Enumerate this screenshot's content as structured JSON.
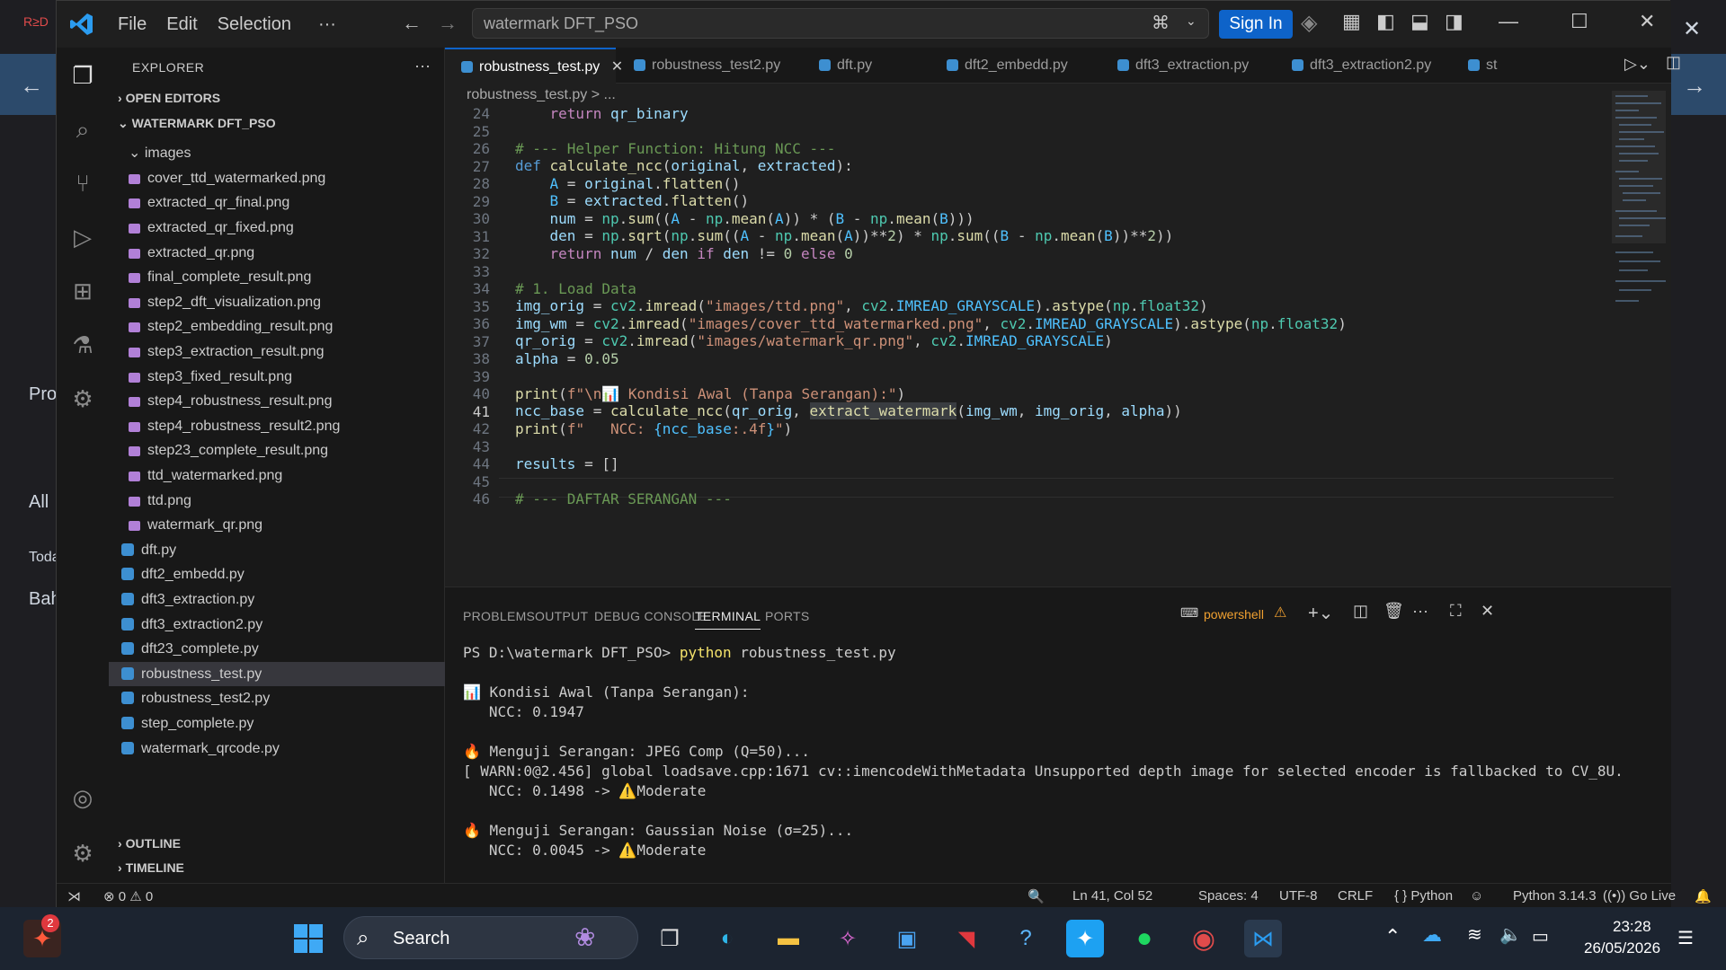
{
  "window": {
    "search_text": "watermark DFT_PSO",
    "sign_in": "Sign In"
  },
  "menu": {
    "file": "File",
    "edit": "Edit",
    "selection": "Selection",
    "more": "···"
  },
  "background": {
    "left_labels": [
      "Pro",
      "All",
      "Toda",
      "Bah"
    ]
  },
  "explorer": {
    "title": "EXPLORER",
    "open_editors": "OPEN EDITORS",
    "project": "WATERMARK DFT_PSO",
    "folder": "images",
    "images": [
      "cover_ttd_watermarked.png",
      "extracted_qr_final.png",
      "extracted_qr_fixed.png",
      "extracted_qr.png",
      "final_complete_result.png",
      "step2_dft_visualization.png",
      "step2_embedding_result.png",
      "step3_extraction_result.png",
      "step3_fixed_result.png",
      "step4_robustness_result.png",
      "step4_robustness_result2.png",
      "step23_complete_result.png",
      "ttd_watermarked.png",
      "ttd.png",
      "watermark_qr.png"
    ],
    "files": [
      "dft.py",
      "dft2_embedd.py",
      "dft3_extraction.py",
      "dft3_extraction2.py",
      "dft23_complete.py",
      "robustness_test.py",
      "robustness_test2.py",
      "step_complete.py",
      "watermark_qrcode.py"
    ],
    "outline": "OUTLINE",
    "timeline": "TIMELINE"
  },
  "tabs": [
    "robustness_test.py",
    "robustness_test2.py",
    "dft.py",
    "dft2_embedd.py",
    "dft3_extraction.py",
    "dft3_extraction2.py",
    "st"
  ],
  "breadcrumb": "robustness_test.py > ...",
  "code": {
    "line_numbers": [
      "24",
      "25",
      "26",
      "27",
      "28",
      "29",
      "30",
      "31",
      "32",
      "33",
      "34",
      "35",
      "36",
      "37",
      "38",
      "39",
      "40",
      "41",
      "42",
      "43",
      "44",
      "45",
      "46"
    ],
    "current_line": "41"
  },
  "panel": {
    "tabs": [
      "PROBLEMS",
      "OUTPUT",
      "DEBUG CONSOLE",
      "TERMINAL",
      "PORTS"
    ],
    "shell": "powershell",
    "terminal": [
      "PS D:\\watermark DFT_PSO> python robustness_test.py",
      "",
      "📊 Kondisi Awal (Tanpa Serangan):",
      "   NCC: 0.1947",
      "",
      "🔥 Menguji Serangan: JPEG Comp (Q=50)...",
      "[ WARN:0@2.456] global loadsave.cpp:1671 cv::imencodeWithMetadata Unsupported depth image for selected encoder is fallbacked to CV_8U.",
      "   NCC: 0.1498 -> ⚠️Moderate",
      "",
      "🔥 Menguji Serangan: Gaussian Noise (σ=25)...",
      "   NCC: 0.0045 -> ⚠️Moderate"
    ]
  },
  "status": {
    "errors": "0",
    "warnings": "0",
    "position": "Ln 41, Col 52",
    "spaces": "Spaces: 4",
    "encoding": "UTF-8",
    "eol": "CRLF",
    "language": "Python",
    "interpreter": "Python 3.14.3",
    "golive": "Go Live"
  },
  "taskbar": {
    "search": "Search",
    "time": "23:28",
    "date": "26/05/2026",
    "badge": "2"
  }
}
